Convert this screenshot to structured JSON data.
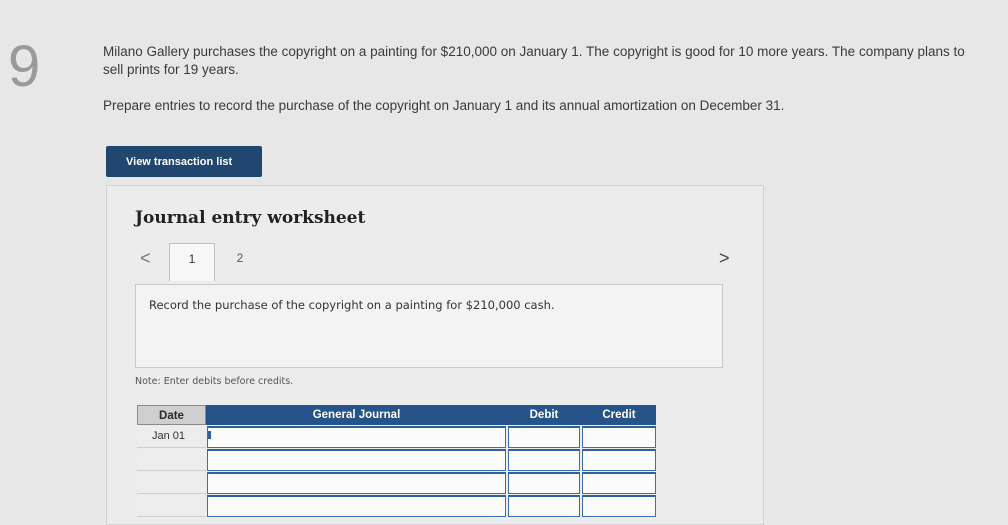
{
  "question": {
    "number": "9",
    "text_line1": "Milano Gallery purchases the copyright on a painting for $210,000 on January 1. The copyright is good for 10 more years. The company plans to sell prints for 19 years.",
    "text_line2": "Prepare entries to record the purchase of the copyright on January 1 and its annual amortization on December 31."
  },
  "buttons": {
    "view_transaction_list": "View transaction list"
  },
  "worksheet": {
    "title": "Journal entry worksheet",
    "prev_symbol": "<",
    "next_symbol": ">",
    "tabs": [
      {
        "label": "1",
        "active": true
      },
      {
        "label": "2",
        "active": false
      }
    ],
    "instruction": "Record the purchase of the copyright on a painting for $210,000 cash.",
    "note": "Note: Enter debits before credits."
  },
  "journal": {
    "headers": {
      "date": "Date",
      "general_journal": "General Journal",
      "debit": "Debit",
      "credit": "Credit"
    },
    "rows": [
      {
        "date": "Jan 01",
        "account": "",
        "debit": "",
        "credit": ""
      },
      {
        "date": "",
        "account": "",
        "debit": "",
        "credit": ""
      },
      {
        "date": "",
        "account": "",
        "debit": "",
        "credit": ""
      },
      {
        "date": "",
        "account": "",
        "debit": "",
        "credit": ""
      }
    ]
  },
  "colors": {
    "primary_button": "#21466f",
    "table_header": "#25538a",
    "input_border": "#3a6fb0"
  }
}
